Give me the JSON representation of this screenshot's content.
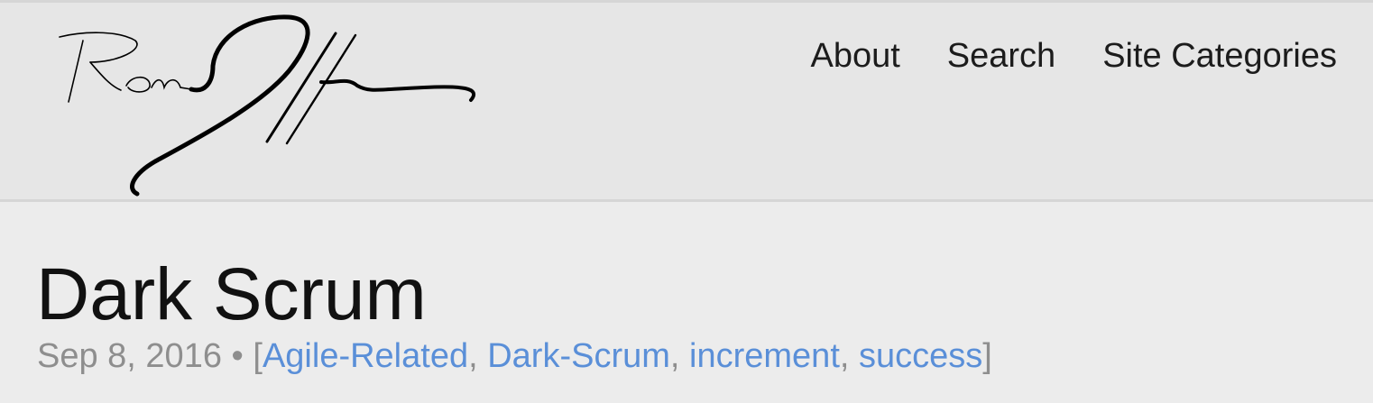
{
  "header": {
    "logo_alt": "Ron Jeffries signature",
    "nav": [
      {
        "label": "About"
      },
      {
        "label": "Search"
      },
      {
        "label": "Site Categories"
      }
    ]
  },
  "post": {
    "title": "Dark Scrum",
    "date": "Sep 8, 2016",
    "separator": " • ",
    "open_bracket": "[",
    "close_bracket": "]",
    "tag_separator": ", ",
    "tags": [
      "Agile-Related",
      "Dark-Scrum",
      "increment",
      "success"
    ]
  },
  "colors": {
    "header_bg": "#e6e6e6",
    "page_bg": "#ececec",
    "link": "#5a8fd8",
    "meta_text": "#8e8e8e",
    "title_text": "#111111"
  }
}
